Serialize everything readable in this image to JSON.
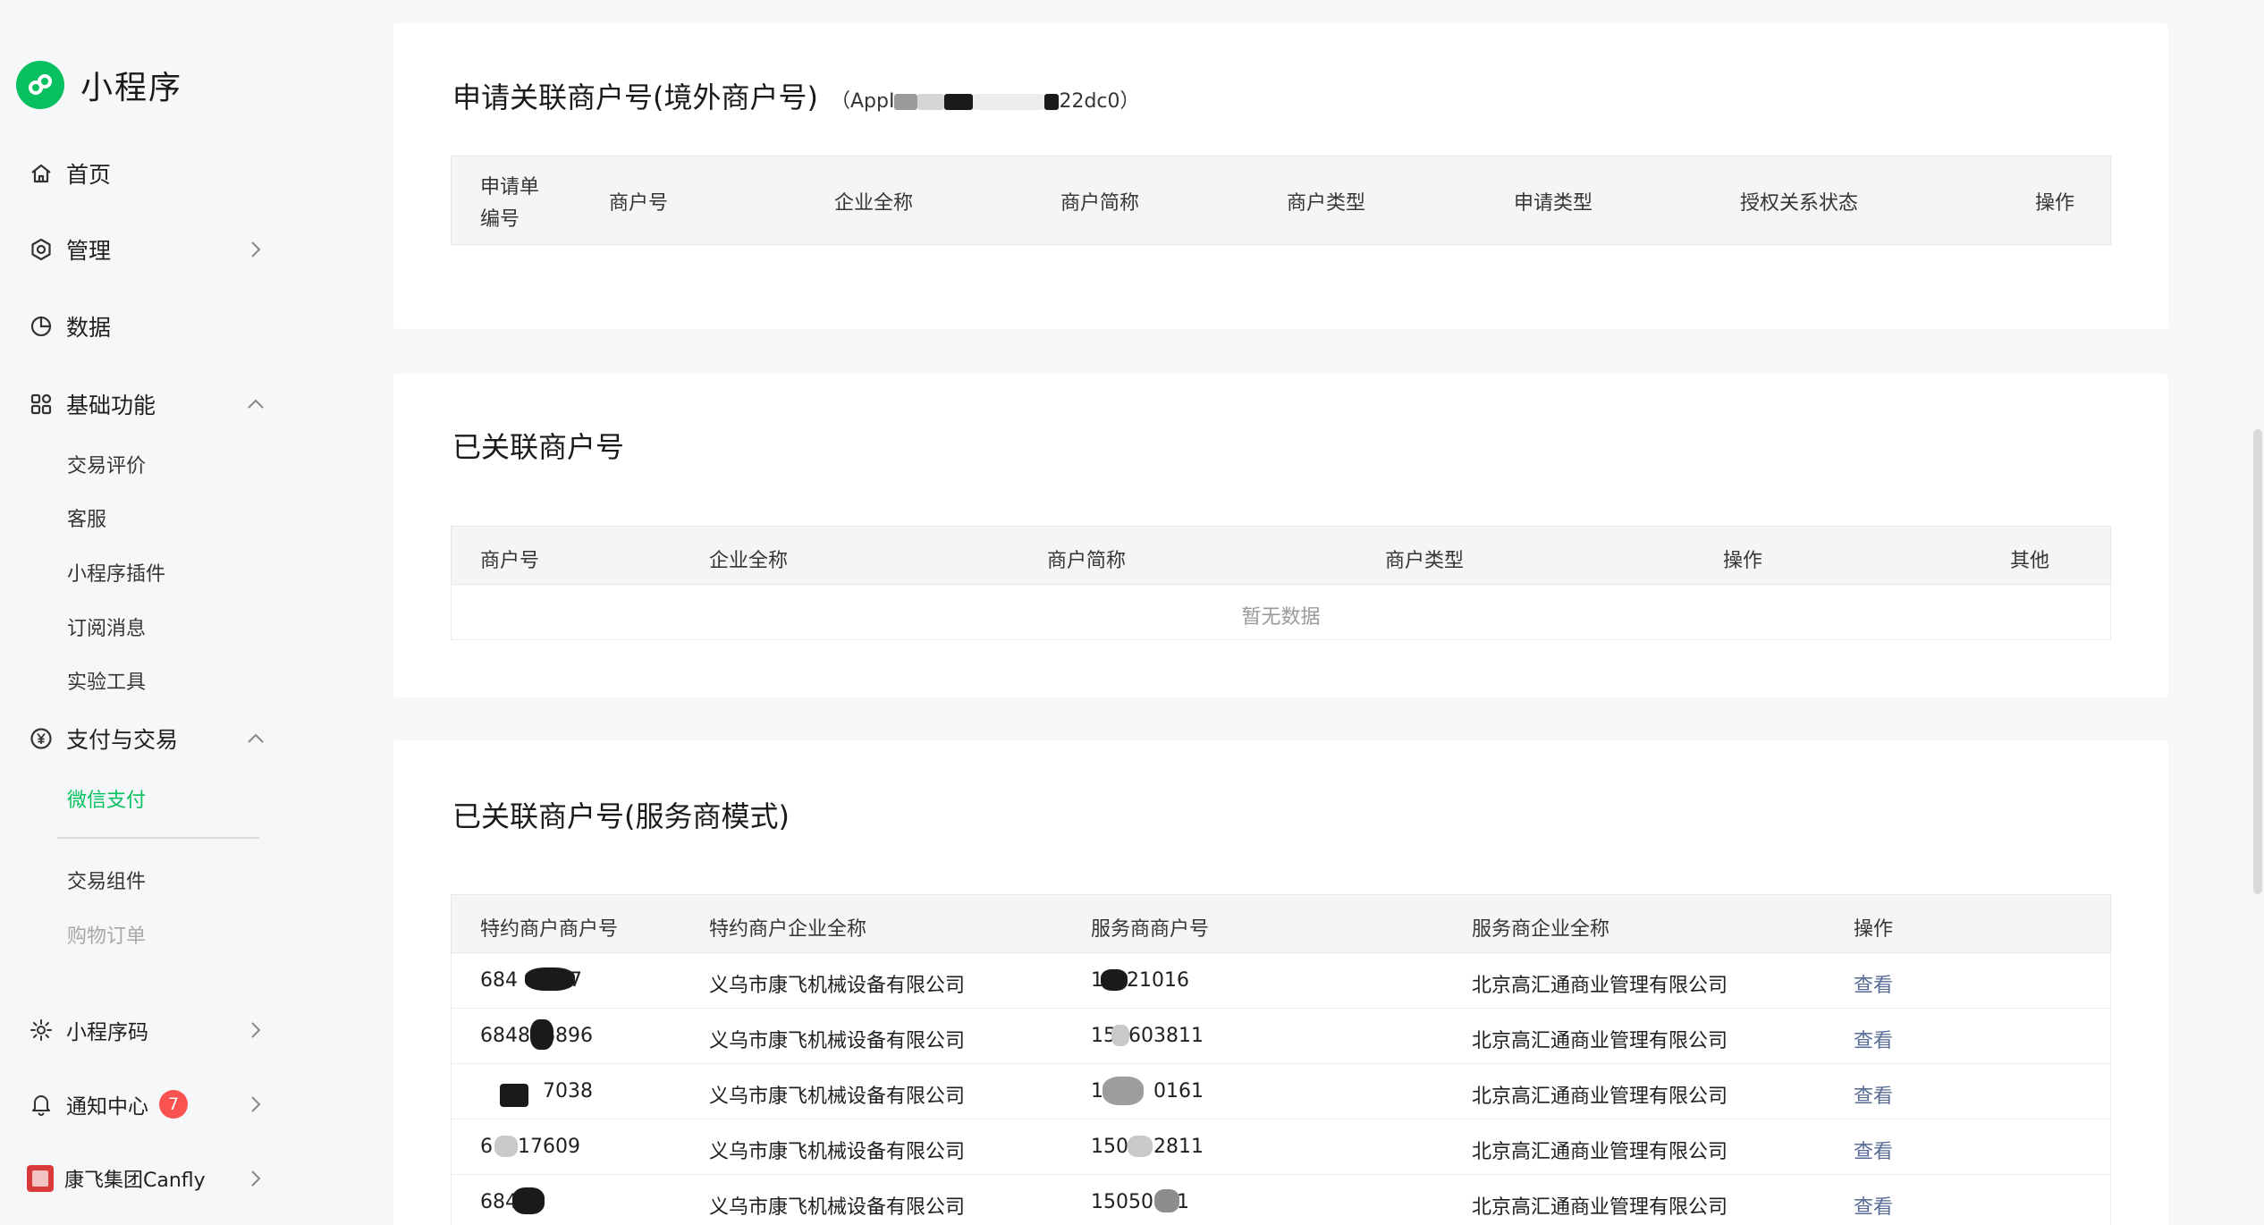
{
  "brand": {
    "name": "小程序"
  },
  "sidebar": {
    "items": [
      {
        "label": "首页"
      },
      {
        "label": "管理"
      },
      {
        "label": "数据"
      },
      {
        "label": "基础功能"
      },
      {
        "label": "支付与交易"
      },
      {
        "label": "小程序码"
      },
      {
        "label": "通知中心",
        "badge": "7"
      },
      {
        "label": "康飞集团Canfly"
      }
    ],
    "basic_sub": [
      "交易评价",
      "客服",
      "小程序插件",
      "订阅消息",
      "实验工具"
    ],
    "pay_sub": [
      "微信支付",
      "交易组件",
      "购物订单"
    ]
  },
  "apply": {
    "title": "申请关联商户号(境外商户号)",
    "appid_prefix": "（AppI",
    "appid_suffix": "22dc0）",
    "headers": [
      "申请单",
      "编号",
      "商户号",
      "企业全称",
      "商户简称",
      "商户类型",
      "申请类型",
      "授权关系状态",
      "操作"
    ]
  },
  "linked": {
    "title": "已关联商户号",
    "headers": [
      "商户号",
      "企业全称",
      "商户简称",
      "商户类型",
      "操作",
      "其他"
    ],
    "empty": "暂无数据"
  },
  "service": {
    "title": "已关联商户号(服务商模式)",
    "headers": [
      "特约商户商户号",
      "特约商户企业全称",
      "服务商商户号",
      "服务商企业全称",
      "操作"
    ],
    "rows": [
      {
        "mch": "684",
        "mch_tail": "7",
        "company": "义乌市康飞机械设备有限公司",
        "sp": "1",
        "sp_tail": "21016",
        "sp_company": "北京高汇通商业管理有限公司",
        "action": "查看"
      },
      {
        "mch": "6848",
        "mch_tail": "6896",
        "company": "义乌市康飞机械设备有限公司",
        "sp": "15",
        "sp_tail": "603811",
        "sp_company": "北京高汇通商业管理有限公司",
        "action": "查看"
      },
      {
        "mch": "",
        "mch_tail": "7038",
        "company": "义乌市康飞机械设备有限公司",
        "sp": "1",
        "sp_tail": "0161",
        "sp_company": "北京高汇通商业管理有限公司",
        "action": "查看"
      },
      {
        "mch": "6",
        "mch_tail": "17609",
        "company": "义乌市康飞机械设备有限公司",
        "sp": "150",
        "sp_tail": "2811",
        "sp_company": "北京高汇通商业管理有限公司",
        "action": "查看"
      },
      {
        "mch": "684",
        "mch_tail": "",
        "company": "义乌市康飞机械设备有限公司",
        "sp": "15050",
        "sp_tail": "1",
        "sp_company": "北京高汇通商业管理有限公司",
        "action": "查看"
      }
    ]
  },
  "colors": {
    "brand": "#07c160",
    "link": "#576b95",
    "badge": "#fa5151"
  }
}
